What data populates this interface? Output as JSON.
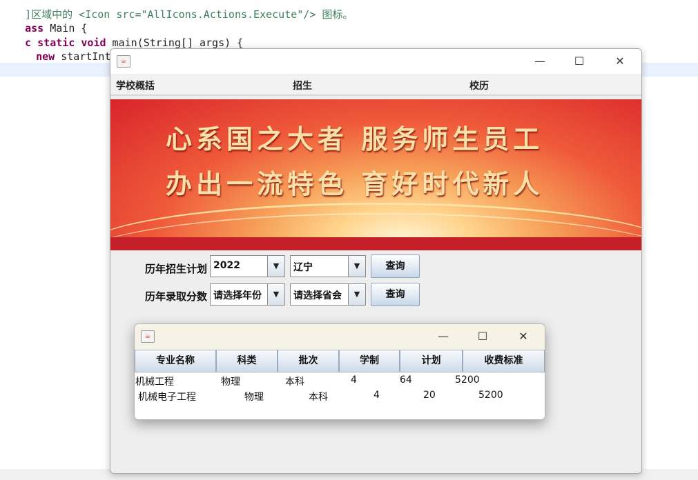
{
  "editor": {
    "line1_comment": "]区域中的 <Icon src=\"AllIcons.Actions.Execute\"/> 图标。",
    "line2_kw": "ass",
    "line2_text": " Main {",
    "line3_kw1": "c static void",
    "line3_text": " main(String[] args) {",
    "line4_kw": "new",
    "line4_text": " startInterface();"
  },
  "main_window": {
    "title_icon": "java-icon",
    "minimize": "—",
    "maximize": "☐",
    "close": "✕",
    "menu": [
      "学校概括",
      "招生",
      "校历"
    ],
    "banner": {
      "slogan_line1": "心系国之大者 服务师生员工",
      "slogan_line2": "办出一流特色 育好时代新人"
    },
    "form": {
      "row1": {
        "label": "历年招生计划",
        "year": "2022",
        "province": "辽宁",
        "button": "查询"
      },
      "row2": {
        "label": "历年录取分数",
        "year": "请选择年份",
        "province": "请选择省会",
        "button": "查询"
      }
    }
  },
  "dialog": {
    "minimize": "—",
    "maximize": "☐",
    "close": "✕",
    "columns": [
      "专业名称",
      "科类",
      "批次",
      "学制",
      "计划",
      "收费标准"
    ],
    "rows": [
      [
        "机械工程",
        "物理",
        "本科",
        "4",
        "64",
        "5200"
      ],
      [
        "机械电子工程",
        "物理",
        "本科",
        "4",
        "20",
        "5200"
      ]
    ]
  },
  "colors": {
    "banner_red": "#d8242a",
    "banner_gold": "#f7e1a8",
    "button_blue": "#c8d7e8"
  }
}
